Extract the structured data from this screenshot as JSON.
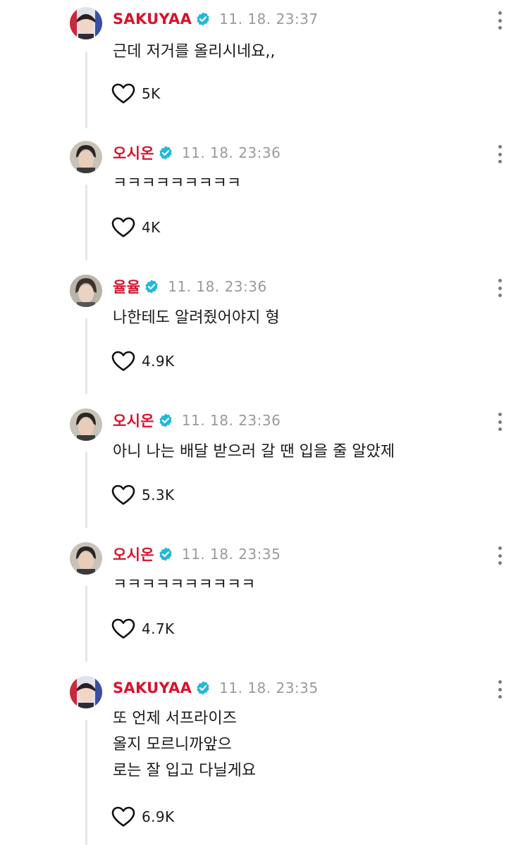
{
  "comments": [
    {
      "username": "SAKUYAA",
      "timestamp": "11. 18. 23:37",
      "text_lines": [
        "근데 저거를 올리시네요,,"
      ],
      "likes": "5K",
      "avatar": "avatar-sakuyaa",
      "verified_icon": "verified-badge-icon"
    },
    {
      "username": "오시온",
      "timestamp": "11. 18. 23:36",
      "text_lines": [
        "ㅋㅋㅋㅋㅋㅋㅋㅋㅋ"
      ],
      "likes": "4K",
      "avatar": "avatar-osion",
      "verified_icon": "verified-badge-icon"
    },
    {
      "username": "율율",
      "timestamp": "11. 18. 23:36",
      "text_lines": [
        "나한테도 알려줬어야지 형"
      ],
      "likes": "4.9K",
      "avatar": "avatar-yulyul",
      "verified_icon": "verified-badge-icon"
    },
    {
      "username": "오시온",
      "timestamp": "11. 18. 23:36",
      "text_lines": [
        "아니 나는 배달 받으러 갈 땐 입을 줄 알았제"
      ],
      "likes": "5.3K",
      "avatar": "avatar-osion",
      "verified_icon": "verified-badge-icon"
    },
    {
      "username": "오시온",
      "timestamp": "11. 18. 23:35",
      "text_lines": [
        "ㅋㅋㅋㅋㅋㅋㅋㅋㅋㅋ"
      ],
      "likes": "4.7K",
      "avatar": "avatar-osion",
      "verified_icon": "verified-badge-icon"
    },
    {
      "username": "SAKUYAA",
      "timestamp": "11. 18. 23:35",
      "text_lines": [
        "또 언제 서프라이즈",
        "올지 모르니까앞으",
        "로는 잘 입고 다닐게요"
      ],
      "likes": "6.9K",
      "avatar": "avatar-sakuyaa",
      "verified_icon": "verified-badge-icon"
    }
  ],
  "icons": {
    "like": "heart-outline-icon",
    "more": "more-vertical-icon",
    "verified": "verified-badge-icon"
  },
  "colors": {
    "username": "#d9122b",
    "verified": "#21b8d8",
    "timestamp": "#9a9a9a",
    "thread_line": "#e6e6e6"
  }
}
